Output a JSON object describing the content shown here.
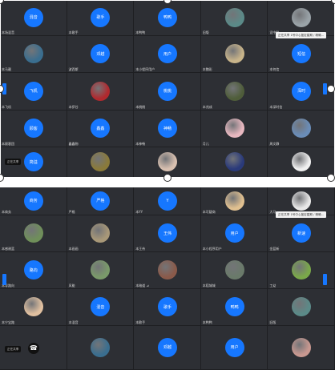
{
  "top": {
    "tip": "正在共享  1号中心鉴定星期 / 精确...",
    "share_chip": "正在共享",
    "rows": [
      [
        {
          "kind": "blue",
          "label": "混音",
          "name": "本场混音"
        },
        {
          "kind": "blue",
          "label": "歌手",
          "name": "本歌手"
        },
        {
          "kind": "blue",
          "label": "鸭鸭",
          "name": "本鸭鸭"
        },
        {
          "kind": "photo",
          "color": "#5b8a88",
          "name": "旧版"
        },
        {
          "kind": "photo",
          "color": "#9aa3a8",
          "name": "设中鲜"
        }
      ],
      [
        {
          "kind": "photo",
          "color": "#3a6e8f",
          "name": "本马靓"
        },
        {
          "kind": "blue",
          "label": "邓越",
          "name": "波西斯"
        },
        {
          "kind": "blue",
          "label": "用户",
          "name": "本小程序用户"
        },
        {
          "kind": "photo",
          "color": "#c8b48a",
          "name": "本魏彩"
        },
        {
          "kind": "blue",
          "label": "短信",
          "name": "本何信"
        }
      ],
      [
        {
          "kind": "blue",
          "label": "飞机",
          "name": "本飞机"
        },
        {
          "kind": "photo",
          "color": "#b0292e",
          "name": "本伊谷"
        },
        {
          "kind": "blue",
          "label": "桃桃",
          "name": "本桃桃"
        },
        {
          "kind": "photo",
          "color": "#4f5d3a",
          "name": "本兆成"
        },
        {
          "kind": "blue",
          "label": "深时",
          "name": "本深时信"
        }
      ],
      [
        {
          "kind": "blue",
          "label": "顾客",
          "name": "本顾客团"
        },
        {
          "kind": "blue",
          "label": "鑫鑫",
          "name": "鑫鑫物"
        },
        {
          "kind": "blue",
          "label": "神畅",
          "name": "本神畅"
        },
        {
          "kind": "photo",
          "color": "#e8b8c0",
          "name": "月儿"
        },
        {
          "kind": "photo",
          "color": "#6a8db8",
          "name": "周文静"
        }
      ],
      [
        {
          "kind": "blue",
          "label": "简溢",
          "name": ""
        },
        {
          "kind": "photo",
          "color": "#8a7a3a",
          "name": ""
        },
        {
          "kind": "photo",
          "color": "#d8c0b0",
          "name": ""
        },
        {
          "kind": "photo",
          "color": "#2a3a7a",
          "name": ""
        },
        {
          "kind": "photo",
          "color": "#f0f0f0",
          "name": ""
        }
      ]
    ]
  },
  "bottom": {
    "tip": "正在共享  1号中心鉴定星期 / 精确...",
    "share_chip": "正在共享",
    "rows": [
      [
        {
          "kind": "blue",
          "label": "商务",
          "name": "本商务"
        },
        {
          "kind": "blue",
          "label": "严格",
          "name": "严格"
        },
        {
          "kind": "blue",
          "label": "Y",
          "name": "本YY"
        },
        {
          "kind": "photo",
          "color": "#e0c090",
          "name": "本可疑商"
        },
        {
          "kind": "photo",
          "color": "#e8e8e8",
          "name": "大马"
        }
      ],
      [
        {
          "kind": "photo",
          "color": "#6f8f5a",
          "name": "本感谢蓝"
        },
        {
          "kind": "photo",
          "color": "#a89878",
          "name": "本画画"
        },
        {
          "kind": "blue",
          "label": "王伟",
          "name": "本王伟"
        },
        {
          "kind": "blue",
          "label": "用户",
          "name": "本小程序用户"
        },
        {
          "kind": "blue",
          "label": "新速",
          "name": "金蓝新"
        }
      ],
      [
        {
          "kind": "blue",
          "label": "路向",
          "name": "本导路向"
        },
        {
          "kind": "photo",
          "color": "#7a9a6a",
          "name": "风能"
        },
        {
          "kind": "photo",
          "color": "#8a5a4a",
          "name": "本暗道 ⊿"
        },
        {
          "kind": "photo",
          "color": "#6a7a6a",
          "name": "本稻城城"
        },
        {
          "kind": "photo",
          "color": "#7aa84a",
          "name": "工幼"
        }
      ],
      [
        {
          "kind": "photo",
          "color": "#e0c0a0",
          "name": "本宁宝路"
        },
        {
          "kind": "blue",
          "label": "混音",
          "name": "本混音"
        },
        {
          "kind": "blue",
          "label": "歌手",
          "name": "本歌手"
        },
        {
          "kind": "blue",
          "label": "鸭鸭",
          "name": "本鸭鸭"
        },
        {
          "kind": "photo",
          "color": "#5b8a88",
          "name": "旧版"
        }
      ],
      [
        {
          "kind": "phone",
          "name": ""
        },
        {
          "kind": "photo",
          "color": "#3a6e8f",
          "name": ""
        },
        {
          "kind": "blue",
          "label": "邓越",
          "name": ""
        },
        {
          "kind": "blue",
          "label": "用户",
          "name": ""
        },
        {
          "kind": "photo",
          "color": "#c89890",
          "name": ""
        }
      ]
    ]
  }
}
